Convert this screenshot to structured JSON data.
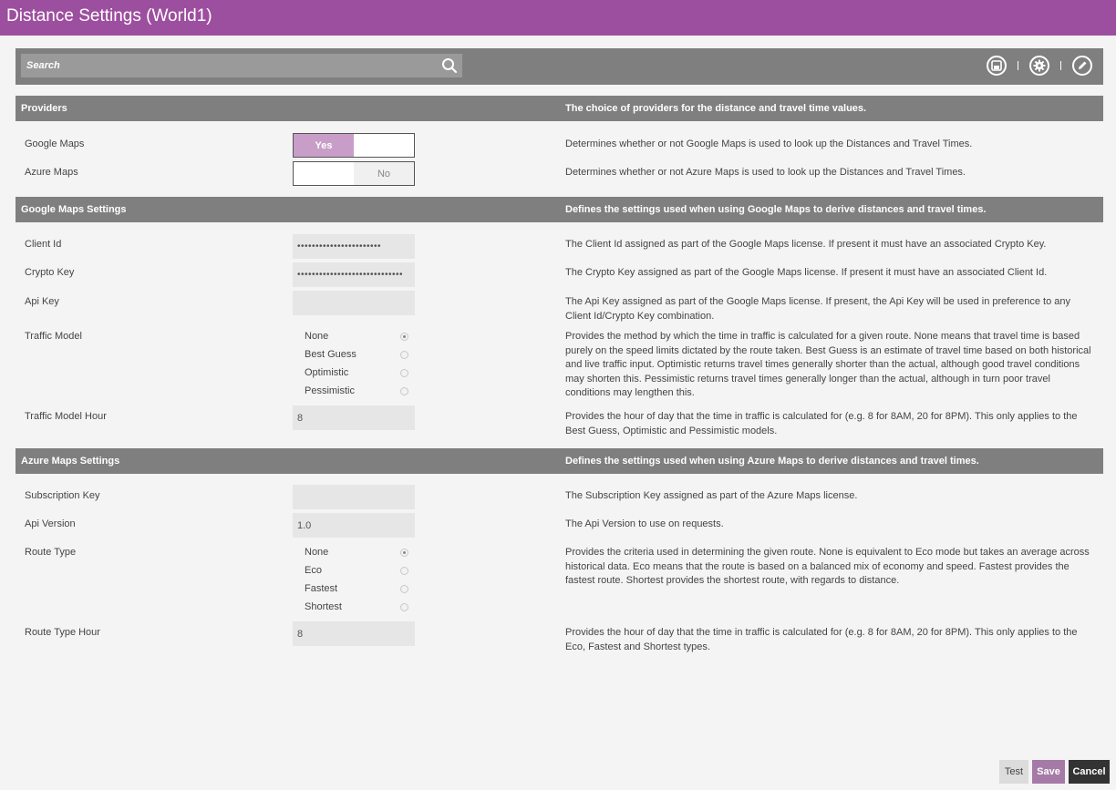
{
  "window": {
    "title": "Distance Settings (World1)"
  },
  "search": {
    "placeholder": "Search"
  },
  "providers": {
    "title": "Providers",
    "description": "The choice of providers for the distance and travel time values.",
    "google": {
      "label": "Google Maps",
      "value": "Yes",
      "description": "Determines whether or not Google Maps is used to look up the Distances and Travel Times."
    },
    "azure": {
      "label": "Azure Maps",
      "value": "No",
      "description": "Determines whether or not Azure Maps is used to look up the Distances and Travel Times."
    }
  },
  "google": {
    "title": "Google Maps Settings",
    "description": "Defines the settings used when using Google Maps to derive distances and travel times.",
    "client_id": {
      "label": "Client Id",
      "value": "•••••••••••••••••••••••",
      "description": "The Client Id assigned as part of the Google Maps license. If present it must have an associated Crypto Key."
    },
    "crypto_key": {
      "label": "Crypto Key",
      "value": "•••••••••••••••••••••••••••••",
      "description": "The Crypto Key assigned as part of the Google Maps license. If present it must have an associated Client Id."
    },
    "api_key": {
      "label": "Api Key",
      "value": "",
      "description": "The Api Key assigned as part of the Google Maps license. If present, the Api Key will be used in preference to any Client Id/Crypto Key combination."
    },
    "traffic_model": {
      "label": "Traffic Model",
      "options": [
        "None",
        "Best Guess",
        "Optimistic",
        "Pessimistic"
      ],
      "selected": "None",
      "description": "Provides the method by which the time in traffic is calculated for a given route. None means that travel time is based purely on the speed limits dictated by the route taken. Best Guess is an estimate of travel time based on both historical and live traffic input. Optimistic returns travel times generally shorter than the actual, although good travel conditions may shorten this. Pessimistic returns travel times generally longer than the actual, although in turn poor travel conditions may lengthen this."
    },
    "traffic_model_hour": {
      "label": "Traffic Model Hour",
      "value": "8",
      "description": "Provides the hour of day that the time in traffic is calculated for (e.g. 8 for 8AM, 20 for 8PM). This only applies to the Best Guess, Optimistic and Pessimistic models."
    }
  },
  "azure": {
    "title": "Azure Maps Settings",
    "description": "Defines the settings used when using Azure Maps to derive distances and travel times.",
    "subscription_key": {
      "label": "Subscription Key",
      "value": "",
      "description": "The Subscription Key assigned as part of the Azure Maps license."
    },
    "api_version": {
      "label": "Api Version",
      "value": "1.0",
      "description": "The Api Version to use on requests."
    },
    "route_type": {
      "label": "Route Type",
      "options": [
        "None",
        "Eco",
        "Fastest",
        "Shortest"
      ],
      "selected": "None",
      "description": "Provides the criteria used in determining the given route. None is equivalent to Eco mode but takes an average across historical data. Eco means that the route is based on a balanced mix of economy and speed. Fastest provides the fastest route. Shortest provides the shortest route, with regards to distance."
    },
    "route_type_hour": {
      "label": "Route Type Hour",
      "value": "8",
      "description": "Provides the hour of day that the time in traffic is calculated for (e.g. 8 for 8AM, 20 for 8PM). This only applies to the Eco, Fastest and Shortest types."
    }
  },
  "buttons": {
    "test": "Test",
    "save": "Save",
    "cancel": "Cancel"
  },
  "icons": {
    "search": "search-icon",
    "save": "floppy-icon",
    "settings": "gear-icon",
    "edit": "pencil-icon"
  },
  "colors": {
    "titlebar": "#9d4f9f",
    "header": "#7f7f7f",
    "toggle_on": "#c89ec9",
    "save_button": "#a57aa7",
    "cancel_button": "#333333"
  }
}
